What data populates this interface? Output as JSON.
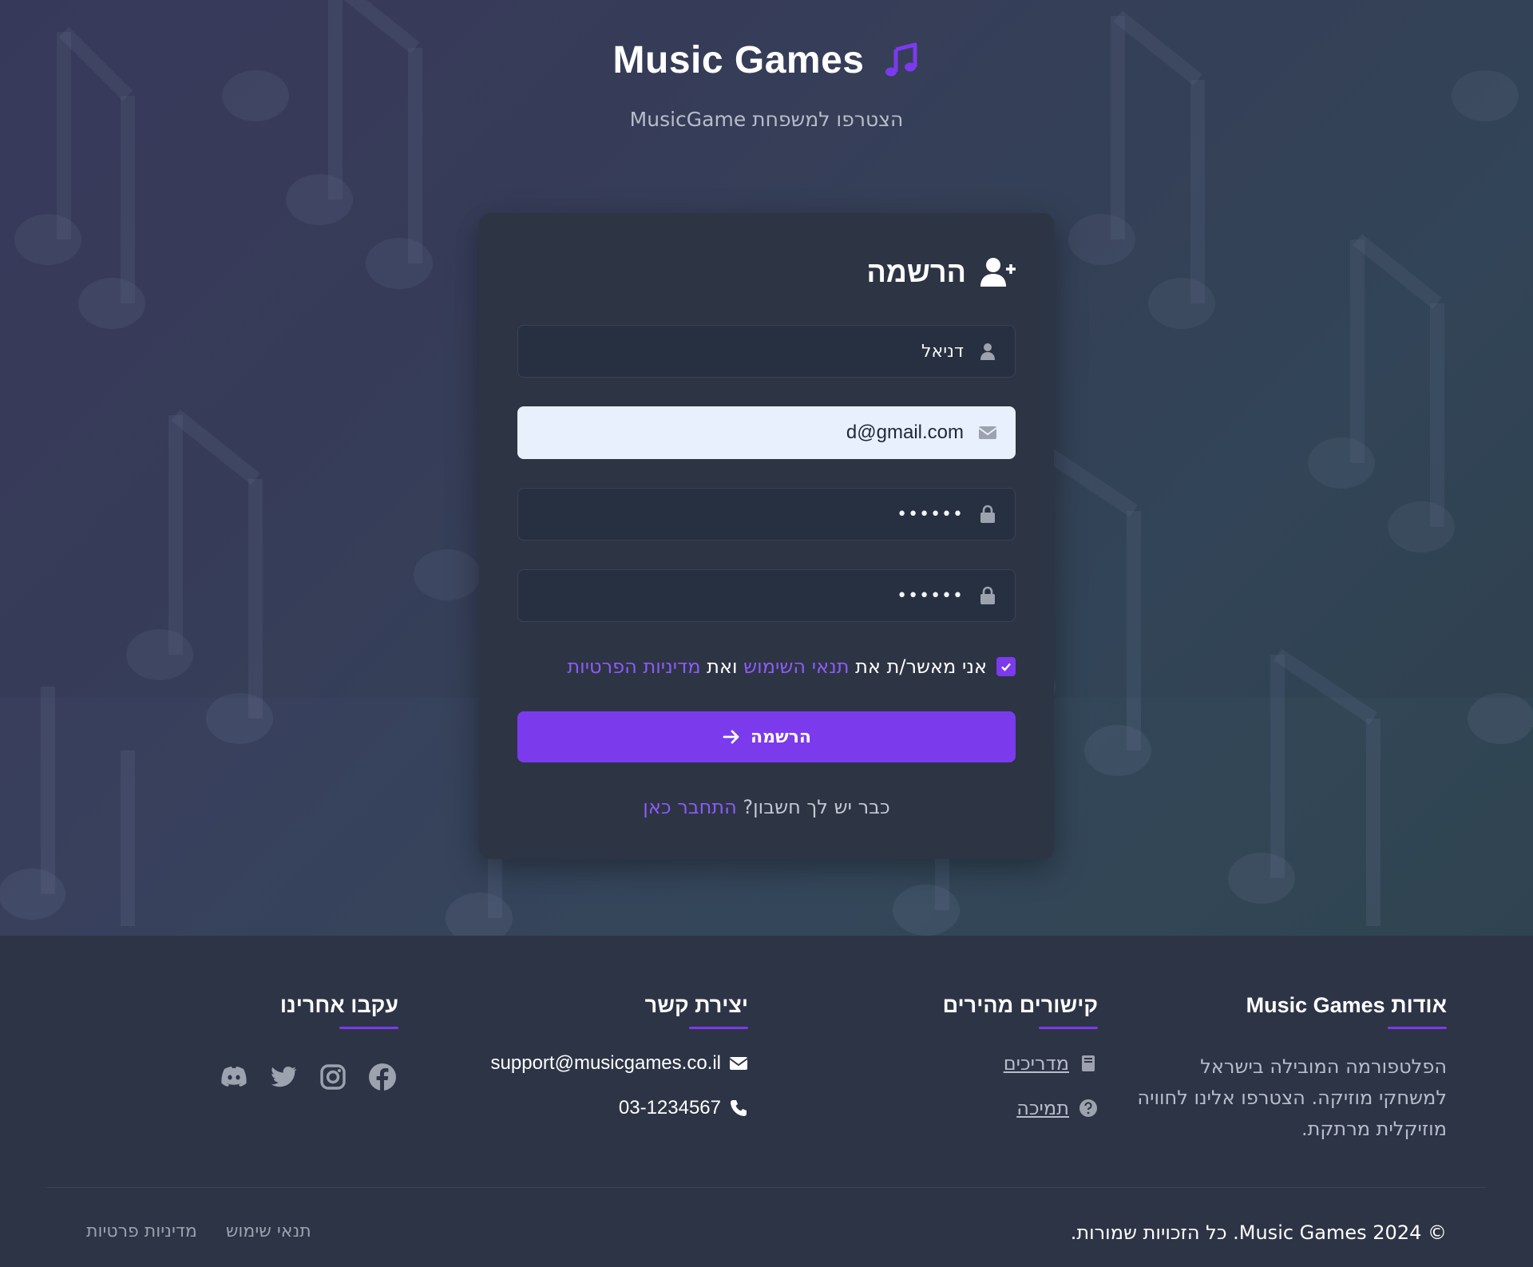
{
  "brand": {
    "title": "Music Games",
    "subtitle": "הצטרפו למשפחת MusicGame",
    "accent": "#7c3aed"
  },
  "register": {
    "title": "הרשמה",
    "title_icon": "user-plus-icon",
    "fields": {
      "name": {
        "value": "דניאל",
        "icon": "user-icon"
      },
      "email": {
        "value": "d@gmail.com",
        "icon": "envelope-icon"
      },
      "password": {
        "value": "••••••",
        "icon": "lock-icon"
      },
      "confirm_password": {
        "value": "••••••",
        "icon": "lock-icon"
      }
    },
    "terms": {
      "checked": true,
      "prefix": "אני מאשר/ת את",
      "terms_link": "תנאי השימוש",
      "and": "ואת",
      "privacy_link": "מדיניות הפרטיות"
    },
    "submit_label": "הרשמה",
    "login_prompt": "כבר יש לך חשבון?",
    "login_link": "התחבר כאן"
  },
  "footer": {
    "about": {
      "title": "אודות Music Games",
      "text": "הפלטפורמה המובילה בישראל למשחקי מוזיקה. הצטרפו אלינו לחוויה מוזיקלית מרתקת."
    },
    "quick_links": {
      "title": "קישורים מהירים",
      "items": [
        {
          "label": "מדריכים",
          "icon": "book-icon"
        },
        {
          "label": "תמיכה",
          "icon": "question-circle-icon"
        }
      ]
    },
    "contact": {
      "title": "יצירת קשר",
      "email": "support@musicgames.co.il",
      "phone": "03-1234567"
    },
    "follow": {
      "title": "עקבו אחרינו",
      "icons": [
        "facebook-icon",
        "instagram-icon",
        "twitter-icon",
        "discord-icon"
      ]
    },
    "copyright": "© 2024 Music Games. כל הזכויות שמורות.",
    "legal": {
      "terms": "תנאי שימוש",
      "privacy": "מדיניות פרטיות"
    }
  }
}
